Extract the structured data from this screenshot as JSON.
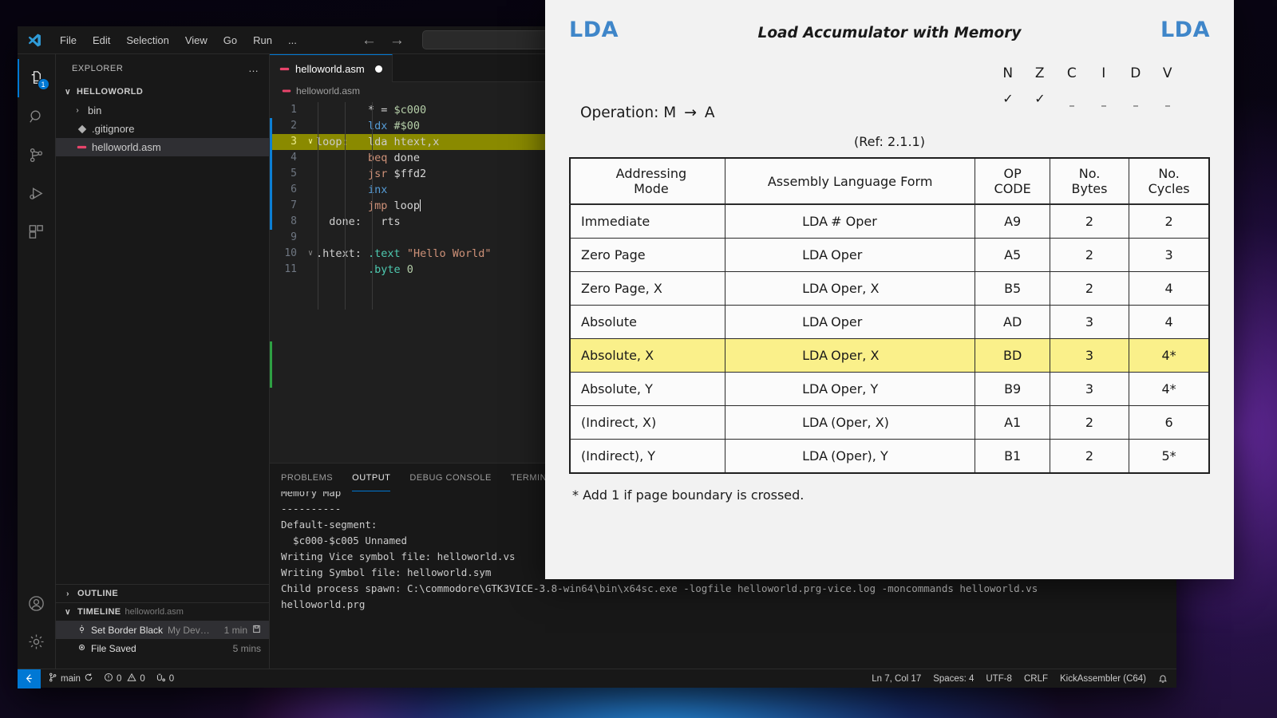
{
  "window": {
    "app": "Visual Studio Code",
    "menu": [
      "File",
      "Edit",
      "Selection",
      "View",
      "Go",
      "Run",
      "..."
    ],
    "nav": {
      "back": "←",
      "forward": "→"
    },
    "command_center_placeholder": ""
  },
  "activitybar": {
    "items": [
      {
        "name": "explorer",
        "icon": "files-icon",
        "badge": "1",
        "active": true
      },
      {
        "name": "search",
        "icon": "search-icon",
        "badge": "",
        "active": false
      },
      {
        "name": "source-control",
        "icon": "source-control-icon",
        "badge": "",
        "active": false
      },
      {
        "name": "run-and-debug",
        "icon": "run-debug-icon",
        "badge": "",
        "active": false
      },
      {
        "name": "extensions",
        "icon": "extensions-icon",
        "badge": "",
        "active": false
      }
    ],
    "bottom": [
      {
        "name": "accounts",
        "icon": "account-icon"
      },
      {
        "name": "manage",
        "icon": "gear-icon"
      }
    ]
  },
  "sidebar": {
    "title": "EXPLORER",
    "more_actions": "…",
    "folder": {
      "label": "HELLOWORLD",
      "chevron": "∨"
    },
    "files": [
      {
        "label": "bin",
        "type": "folder",
        "chevron": "›",
        "selected": false
      },
      {
        "label": ".gitignore",
        "type": "file",
        "icon": "gitignore-icon",
        "selected": false
      },
      {
        "label": "helloworld.asm",
        "type": "file",
        "icon": "asm-icon",
        "selected": true
      }
    ],
    "outline": {
      "label": "OUTLINE",
      "chevron": "›"
    },
    "timeline": {
      "label": "TIMELINE",
      "chevron": "∨",
      "subject": "helloworld.asm",
      "entries": [
        {
          "label": "Set Border Black",
          "author": "My Dev…",
          "when": "1 min",
          "icon": "commit-icon",
          "trailing_icon": "save-icon",
          "selected": true
        },
        {
          "label": "File Saved",
          "author": "",
          "when": "5 mins",
          "icon": "circle-dot-icon",
          "trailing_icon": "",
          "selected": false
        }
      ]
    }
  },
  "editor": {
    "tab": {
      "label": "helloworld.asm",
      "dirty": true,
      "icon": "asm-icon"
    },
    "breadcrumb": "helloworld.asm",
    "lines": [
      {
        "n": "1",
        "fold": "",
        "text": "        * = $c000",
        "hl": false
      },
      {
        "n": "2",
        "fold": "",
        "text": "        ldx #$00",
        "hl": false
      },
      {
        "n": "3",
        "fold": "∨",
        "text": "loop:   lda htext,x",
        "hl": true
      },
      {
        "n": "4",
        "fold": "",
        "text": "        beq done",
        "hl": false
      },
      {
        "n": "5",
        "fold": "",
        "text": "        jsr $ffd2",
        "hl": false
      },
      {
        "n": "6",
        "fold": "",
        "text": "        inx",
        "hl": false
      },
      {
        "n": "7",
        "fold": "",
        "text": "        jmp loop",
        "hl": false
      },
      {
        "n": "8",
        "fold": "",
        "text": "done:   rts",
        "hl": false
      },
      {
        "n": "9",
        "fold": "",
        "text": "",
        "hl": false
      },
      {
        "n": "10",
        "fold": "∨",
        "text": ".htext: .text \"Hello World\"",
        "hl": false
      },
      {
        "n": "11",
        "fold": "",
        "text": "        .byte 0",
        "hl": false
      }
    ]
  },
  "panel": {
    "tabs": [
      {
        "label": "PROBLEMS",
        "active": false
      },
      {
        "label": "OUTPUT",
        "active": true
      },
      {
        "label": "DEBUG CONSOLE",
        "active": false
      },
      {
        "label": "TERMINAL",
        "active": false
      }
    ],
    "output": [
      "Memory Map",
      "----------",
      "Default-segment:",
      "  $c000-$c005 Unnamed",
      "",
      "Writing Vice symbol file: helloworld.vs",
      "Writing Symbol file: helloworld.sym",
      "",
      "Child process spawn: C:\\commodore\\GTK3VICE-3.8-win64\\bin\\x64sc.exe -logfile helloworld.prg-vice.log -moncommands helloworld.vs",
      "helloworld.prg"
    ]
  },
  "statusbar": {
    "remote_icon": "remote-window-icon",
    "branch": "main",
    "sync_icon": "sync-icon",
    "errors": "0",
    "warnings": "0",
    "ports": "0",
    "position": "Ln 7, Col 17",
    "indentation": "Spaces: 4",
    "encoding": "UTF-8",
    "eol": "CRLF",
    "language": "KickAssembler (C64)",
    "bell_icon": "bell-icon"
  },
  "lda_doc": {
    "mnemonic_left": "LDA",
    "mnemonic_right": "LDA",
    "title": "Load Accumulator with Memory",
    "operation_label": "Operation:",
    "operation": "M → A",
    "operation_src": "M",
    "operation_arrow": "→",
    "operation_dst": "A",
    "reference": "(Ref:  2.1.1)",
    "flags": {
      "letters": [
        "N",
        "Z",
        "C",
        "I",
        "D",
        "V"
      ],
      "marks": [
        "✓",
        "✓",
        "–",
        "–",
        "–",
        "–"
      ]
    },
    "table": {
      "headers": [
        "Addressing Mode",
        "Assembly Language Form",
        "OP CODE",
        "No. Bytes",
        "No. Cycles"
      ],
      "header_lines": [
        [
          "Addressing",
          "Mode"
        ],
        [
          "Assembly Language Form",
          ""
        ],
        [
          "OP",
          "CODE"
        ],
        [
          "No.",
          "Bytes"
        ],
        [
          "No.",
          "Cycles"
        ]
      ],
      "rows": [
        {
          "mode": "Immediate",
          "mnemonic": "LDA",
          "operand": "#  Oper",
          "opcode": "A9",
          "bytes": "2",
          "cycles": "2",
          "highlight": false
        },
        {
          "mode": "Zero Page",
          "mnemonic": "LDA",
          "operand": "Oper",
          "opcode": "A5",
          "bytes": "2",
          "cycles": "3",
          "highlight": false
        },
        {
          "mode": "Zero Page, X",
          "mnemonic": "LDA",
          "operand": "Oper, X",
          "opcode": "B5",
          "bytes": "2",
          "cycles": "4",
          "highlight": false
        },
        {
          "mode": "Absolute",
          "mnemonic": "LDA",
          "operand": "Oper",
          "opcode": "AD",
          "bytes": "3",
          "cycles": "4",
          "highlight": false
        },
        {
          "mode": "Absolute, X",
          "mnemonic": "LDA",
          "operand": "Oper, X",
          "opcode": "BD",
          "bytes": "3",
          "cycles": "4*",
          "highlight": true
        },
        {
          "mode": "Absolute, Y",
          "mnemonic": "LDA",
          "operand": "Oper, Y",
          "opcode": "B9",
          "bytes": "3",
          "cycles": "4*",
          "highlight": false
        },
        {
          "mode": "(Indirect, X)",
          "mnemonic": "LDA",
          "operand": "(Oper, X)",
          "opcode": "A1",
          "bytes": "2",
          "cycles": "6",
          "highlight": false
        },
        {
          "mode": "(Indirect), Y",
          "mnemonic": "LDA",
          "operand": "(Oper), Y",
          "opcode": "B1",
          "bytes": "2",
          "cycles": "5*",
          "highlight": false
        }
      ]
    },
    "footnote": "* Add 1 if page boundary is crossed.",
    "colors": {
      "mnemonic": "#3f86c9",
      "highlight": "#faf08a"
    }
  }
}
